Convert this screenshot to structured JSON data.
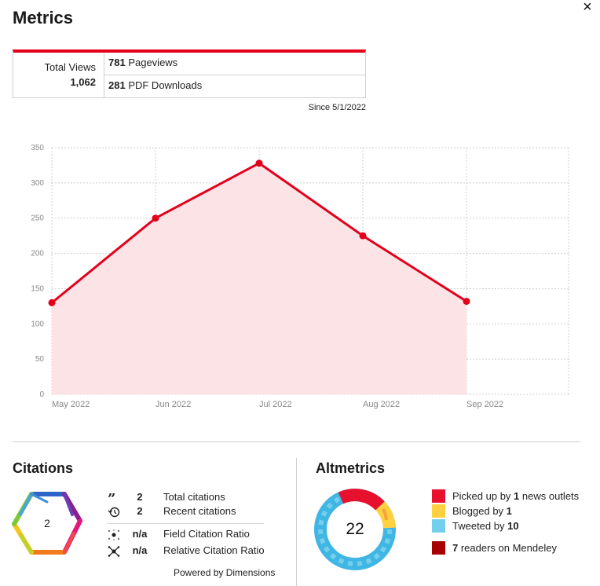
{
  "header": {
    "title": "Metrics",
    "close_label": "×"
  },
  "views": {
    "total_label": "Total Views",
    "total_value": "1,062",
    "pageviews_value": "781",
    "pageviews_label": " Pageviews",
    "pdf_value": "281",
    "pdf_label": " PDF Downloads",
    "since": "Since 5/1/2022"
  },
  "colors": {
    "accent": "#e3001b",
    "area_fill": "#fbe3e6",
    "grid": "#cfcfcf",
    "tick_text": "#888888"
  },
  "chart_data": {
    "type": "area",
    "x": [
      "May 2022",
      "Jun 2022",
      "Jul 2022",
      "Aug 2022",
      "Sep 2022"
    ],
    "series": [
      {
        "values": [
          130,
          250,
          328,
          225,
          132
        ]
      }
    ],
    "ylim": [
      0,
      350
    ],
    "yticks": [
      0,
      50,
      100,
      150,
      200,
      250,
      300,
      350
    ],
    "grid": true
  },
  "citations": {
    "title": "Citations",
    "badge_value": "2",
    "rows": [
      {
        "icon": "quote-icon",
        "value": "2",
        "label": "Total citations"
      },
      {
        "icon": "history-icon",
        "value": "2",
        "label": "Recent citations"
      },
      {
        "icon": "field-ratio-icon",
        "value": "n/a",
        "label": "Field Citation Ratio"
      },
      {
        "icon": "relative-ratio-icon",
        "value": "n/a",
        "label": "Relative Citation Ratio"
      }
    ],
    "powered_by": "Powered by Dimensions"
  },
  "altmetrics": {
    "title": "Altmetrics",
    "score": "22",
    "items": [
      {
        "color": "#e8112d",
        "prefix": "Picked up by ",
        "count": "1",
        "suffix": " news outlets"
      },
      {
        "color": "#ffd140",
        "prefix": "Blogged by ",
        "count": "1",
        "suffix": ""
      },
      {
        "color": "#74cfed",
        "prefix": "Tweeted by ",
        "count": "10",
        "suffix": ""
      },
      {
        "color": "#a60000",
        "prefix": "",
        "count": "7",
        "suffix": " readers on Mendeley"
      }
    ]
  }
}
